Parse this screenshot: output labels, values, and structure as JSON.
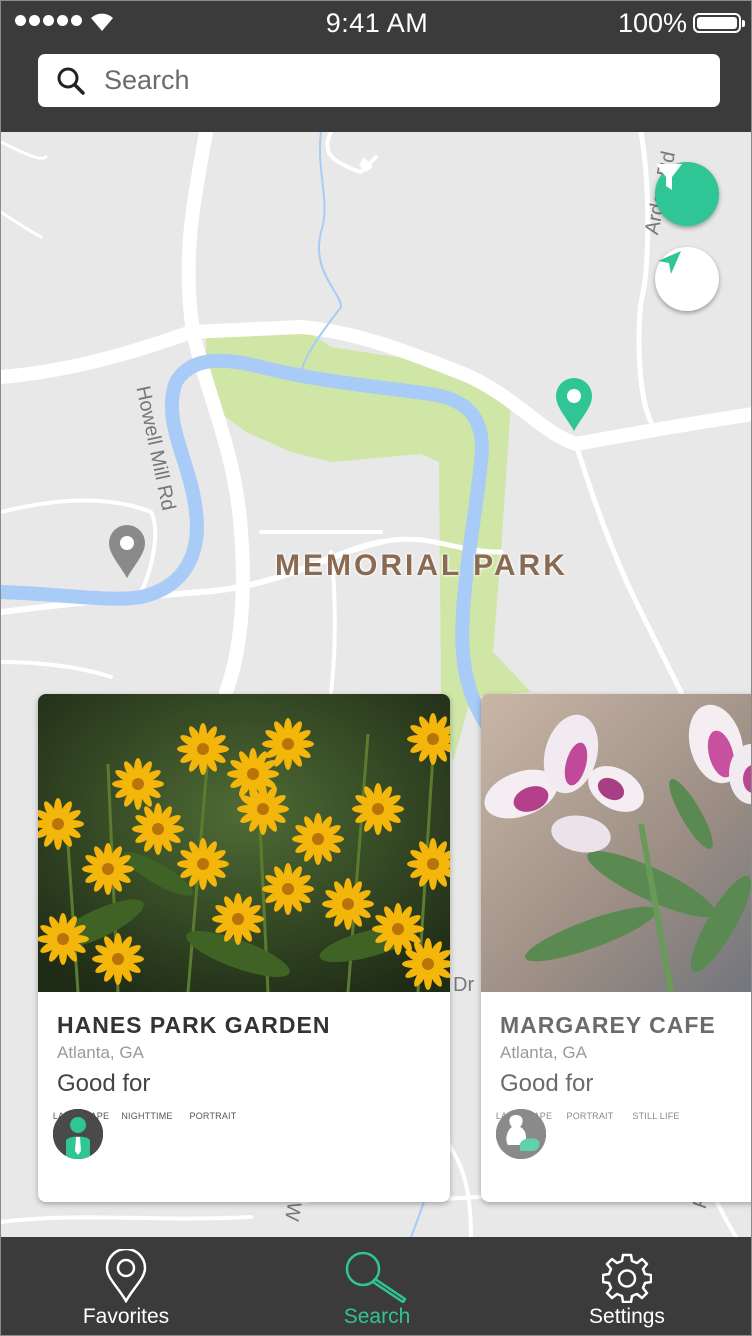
{
  "status_bar": {
    "time": "9:41 AM",
    "battery": "100%"
  },
  "search": {
    "placeholder": "Search",
    "value": ""
  },
  "map": {
    "park_label": "MEMORIAL PARK",
    "road_labels": [
      "Howell Mill Rd",
      "Arden Rd",
      "Dr",
      "W",
      "Rd"
    ],
    "pins": [
      {
        "name": "selected-pin",
        "color": "#2fc594"
      },
      {
        "name": "unselected-pin",
        "color": "#8a8a8a"
      }
    ]
  },
  "cards": [
    {
      "title": "HANES PARK GARDEN",
      "location": "Atlanta, GA",
      "good_for_label": "Good for",
      "photo": "yellow-flowers",
      "tags": [
        "LANDSCAPE",
        "NIGHTTIME",
        "PORTRAIT"
      ]
    },
    {
      "title": "MARGAREY CAFE",
      "location": "Atlanta, GA",
      "good_for_label": "Good for",
      "photo": "pink-white-lilies",
      "tags": [
        "LANDSCAPE",
        "PORTRAIT",
        "STILL LIFE"
      ]
    }
  ],
  "tabbar": {
    "items": [
      {
        "label": "Favorites",
        "icon": "map-pin-icon",
        "active": false
      },
      {
        "label": "Search",
        "icon": "search-icon",
        "active": true
      },
      {
        "label": "Settings",
        "icon": "gear-icon",
        "active": false
      }
    ]
  },
  "colors": {
    "accent": "#2fc594",
    "bar": "#3b3b3b",
    "park": "#cfe6a6",
    "water": "#a8cbf7"
  }
}
